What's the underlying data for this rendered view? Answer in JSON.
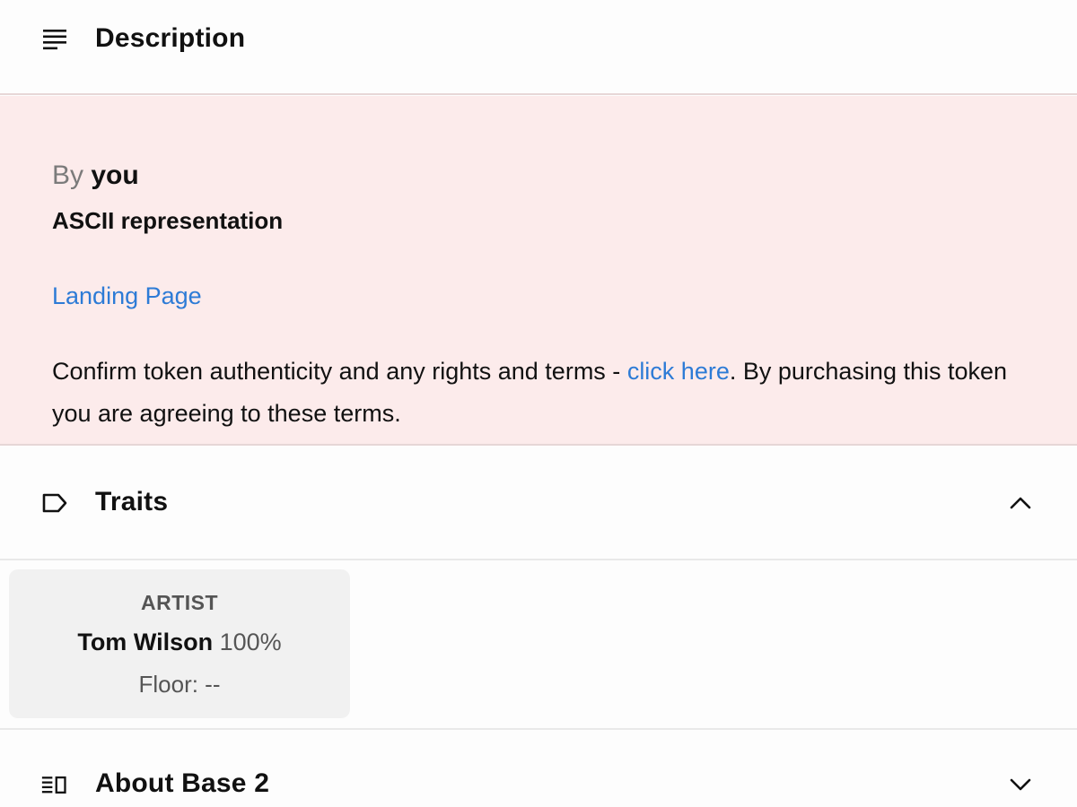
{
  "description": {
    "title": "Description",
    "icon": "description-lines-icon",
    "by_prefix": "By",
    "by_user": "you",
    "heading": "ASCII representation",
    "landing_link": "Landing Page",
    "terms_before": "Confirm token authenticity and any rights and terms - ",
    "terms_link": "click here",
    "terms_after": ". By purchasing this token you are agreeing to these terms.",
    "background_color": "#fcebeb",
    "link_color": "#2d7bd6"
  },
  "traits": {
    "title": "Traits",
    "icon": "tag-icon",
    "expanded": true,
    "items": [
      {
        "type": "ARTIST",
        "value": "Tom Wilson",
        "percent": "100%",
        "floor": "Floor: --"
      }
    ]
  },
  "about": {
    "title": "About Base 2",
    "icon": "about-list-icon",
    "expanded": false
  }
}
